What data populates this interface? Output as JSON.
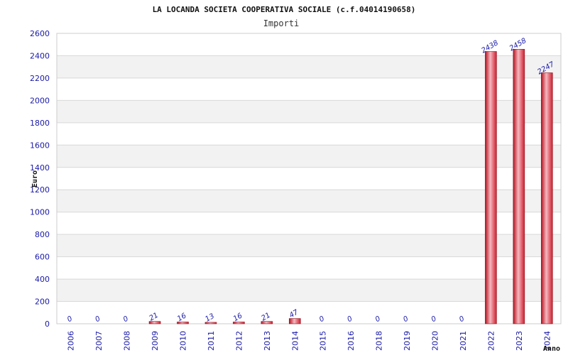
{
  "chart_data": {
    "type": "bar",
    "title": "LA LOCANDA SOCIETA COOPERATIVA SOCIALE (c.f.04014190658)",
    "subtitle": "Importi",
    "xlabel": "Anno",
    "ylabel": "Euro",
    "categories": [
      "2006",
      "2007",
      "2008",
      "2009",
      "2010",
      "2011",
      "2012",
      "2013",
      "2014",
      "2015",
      "2016",
      "2018",
      "2019",
      "2020",
      "2021",
      "2022",
      "2023",
      "2024"
    ],
    "values": [
      0,
      0,
      0,
      21,
      16,
      13,
      16,
      21,
      47,
      0,
      0,
      0,
      0,
      0,
      0,
      2438,
      2458,
      2247
    ],
    "data_labels": [
      "0",
      "0",
      "0",
      "21",
      "16",
      "13",
      "16",
      "21",
      "47",
      "0",
      "0",
      "0",
      "0",
      "0",
      "0",
      "2438",
      "2458",
      "2247"
    ],
    "ylim": [
      0,
      2600
    ],
    "yticks": [
      "0",
      "200",
      "400",
      "600",
      "800",
      "1000",
      "1200",
      "1400",
      "1600",
      "1800",
      "2000",
      "2200",
      "2400",
      "2600"
    ],
    "grid": true,
    "colors": {
      "bar": "#dd2233",
      "bar_highlight": "#f6b8bf",
      "bar_edge": "#8c1420",
      "band": "#f2f2f2",
      "gridline": "#d8d8d8",
      "tick_text": "#1a1aa8"
    }
  }
}
